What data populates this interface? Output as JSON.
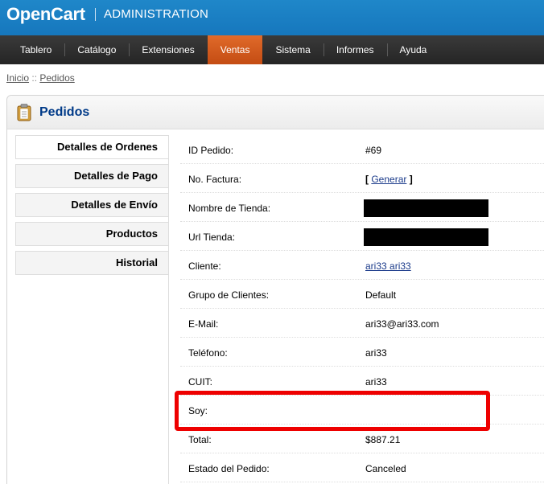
{
  "header": {
    "logo": "OpenCart",
    "subtitle": "ADMINISTRATION"
  },
  "menu": {
    "items": [
      {
        "label": "Tablero",
        "selected": false
      },
      {
        "label": "Catálogo",
        "selected": false
      },
      {
        "label": "Extensiones",
        "selected": false
      },
      {
        "label": "Ventas",
        "selected": true
      },
      {
        "label": "Sistema",
        "selected": false
      },
      {
        "label": "Informes",
        "selected": false
      },
      {
        "label": "Ayuda",
        "selected": false
      }
    ]
  },
  "breadcrumb": {
    "home": "Inicio",
    "separator": "::",
    "current": "Pedidos"
  },
  "page": {
    "title": "Pedidos",
    "icon": "clipboard-icon"
  },
  "tabs": [
    {
      "label": "Detalles de Ordenes",
      "selected": true
    },
    {
      "label": "Detalles de Pago",
      "selected": false
    },
    {
      "label": "Detalles de Envío",
      "selected": false
    },
    {
      "label": "Productos",
      "selected": false
    },
    {
      "label": "Historial",
      "selected": false
    }
  ],
  "details": {
    "order_id": {
      "label": "ID Pedido:",
      "value": "#69"
    },
    "invoice": {
      "label": "No. Factura:",
      "open": "[ ",
      "link": "Generar",
      "close": " ]"
    },
    "store_name": {
      "label": "Nombre de Tienda:",
      "redacted": true
    },
    "store_url": {
      "label": "Url Tienda:",
      "redacted": true
    },
    "customer": {
      "label": "Cliente:",
      "value": "ari33 ari33"
    },
    "customer_group": {
      "label": "Grupo de Clientes:",
      "value": "Default"
    },
    "email": {
      "label": "E-Mail:",
      "value": "ari33@ari33.com"
    },
    "telephone": {
      "label": "Teléfono:",
      "value": "ari33"
    },
    "cuit": {
      "label": "CUIT:",
      "value": "ari33"
    },
    "soy": {
      "label": "Soy:",
      "value": ""
    },
    "total": {
      "label": "Total:",
      "value": "$887.21"
    },
    "status": {
      "label": "Estado del Pedido:",
      "value": "Canceled"
    }
  },
  "colors": {
    "header_blue": "#1a7fc3",
    "menu_dark": "#2e2e2e",
    "menu_active": "#d45a1f",
    "title_blue": "#003a88",
    "highlight_red": "#ee0000"
  }
}
